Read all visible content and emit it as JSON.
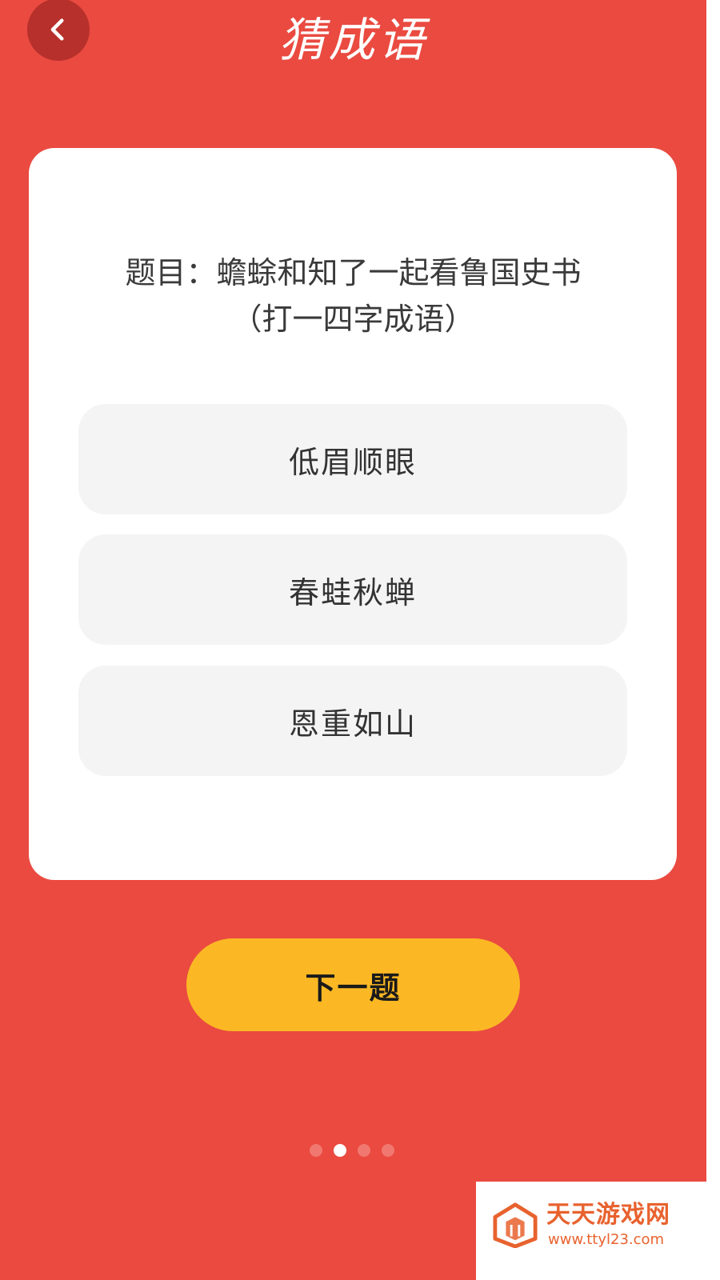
{
  "header": {
    "title": "猜成语",
    "back_icon": "chevron-left-icon"
  },
  "quiz": {
    "question_line1": "题目：蟾蜍和知了一起看鲁国史书",
    "question_line2": "（打一四字成语）",
    "options": [
      "低眉顺眼",
      "春蛙秋蝉",
      "恩重如山"
    ]
  },
  "actions": {
    "next_label": "下一题"
  },
  "pagination": {
    "total": 4,
    "current": 2
  },
  "watermark": {
    "name": "天天游戏网",
    "url": "www.ttyl23.com"
  },
  "colors": {
    "background": "#ea4a40",
    "card": "#ffffff",
    "option_bg": "#f4f4f4",
    "next_button": "#fbb824",
    "watermark_text": "#e8622e"
  }
}
